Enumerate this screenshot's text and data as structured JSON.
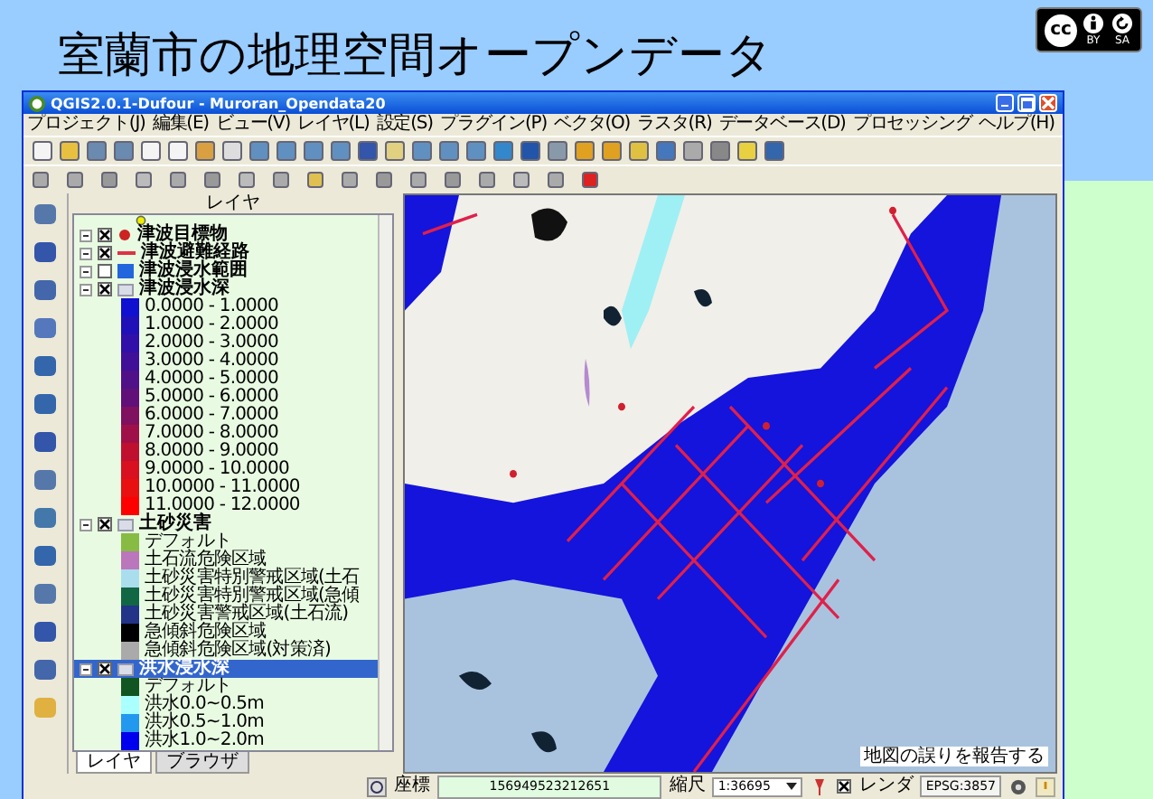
{
  "slide": {
    "title": "室蘭市の地理空間オープンデータ",
    "license": {
      "logo": "cc",
      "labels": [
        "BY",
        "SA"
      ]
    }
  },
  "window": {
    "title": "QGIS2.0.1-Dufour - Muroran_Opendata20"
  },
  "menu": [
    "プロジェクト(J)",
    "編集(E)",
    "ビュー(V)",
    "レイヤ(L)",
    "設定(S)",
    "プラグイン(P)",
    "ベクタ(O)",
    "ラスタ(R)",
    "データベース(D)",
    "プロセッシング",
    "ヘルプ(H)"
  ],
  "layers_panel": {
    "title": "レイヤ",
    "layers": [
      {
        "name": "津波目標物",
        "checked": true,
        "selected": false,
        "expanded": true,
        "symbol": {
          "kind": "point",
          "color": "#cc2222"
        }
      },
      {
        "name": "津波避難経路",
        "checked": true,
        "selected": false,
        "expanded": true,
        "symbol": {
          "kind": "line",
          "color": "#dd3344"
        }
      },
      {
        "name": "津波浸水範囲",
        "checked": false,
        "selected": false,
        "expanded": true,
        "symbol": {
          "kind": "polygon",
          "color": "#2266dd"
        }
      },
      {
        "name": "津波浸水深",
        "checked": true,
        "selected": false,
        "expanded": true,
        "children": [
          {
            "label": "0.0000 - 1.0000",
            "color": "#1010d0"
          },
          {
            "label": "1.0000 - 2.0000",
            "color": "#2010b8"
          },
          {
            "label": "2.0000 - 3.0000",
            "color": "#3010a8"
          },
          {
            "label": "3.0000 - 4.0000",
            "color": "#401098"
          },
          {
            "label": "4.0000 - 5.0000",
            "color": "#501088"
          },
          {
            "label": "5.0000 - 6.0000",
            "color": "#601078"
          },
          {
            "label": "6.0000 - 7.0000",
            "color": "#801060"
          },
          {
            "label": "7.0000 - 8.0000",
            "color": "#a01048"
          },
          {
            "label": "8.0000 - 9.0000",
            "color": "#c01030"
          },
          {
            "label": "9.0000 - 10.0000",
            "color": "#d81020"
          },
          {
            "label": "10.0000 - 11.0000",
            "color": "#e81010"
          },
          {
            "label": "11.0000 - 12.0000",
            "color": "#ff0000"
          }
        ]
      },
      {
        "name": "土砂災害",
        "checked": true,
        "selected": false,
        "expanded": true,
        "children": [
          {
            "label": "デフォルト",
            "color": "#88bb44"
          },
          {
            "label": "土石流危険区域",
            "color": "#bb77bb"
          },
          {
            "label": "土砂災害特別警戒区域(土石",
            "color": "#aaddee"
          },
          {
            "label": "土砂災害特別警戒区域(急傾",
            "color": "#116644"
          },
          {
            "label": "土砂災害警戒区域(土石流)",
            "color": "#223388"
          },
          {
            "label": "急傾斜危険区域",
            "color": "#000000"
          },
          {
            "label": "急傾斜危険区域(対策済)",
            "color": "#aaaaaa"
          }
        ]
      },
      {
        "name": "洪水浸水深",
        "checked": true,
        "selected": true,
        "expanded": true,
        "children": [
          {
            "label": "デフォルト",
            "color": "#115522"
          },
          {
            "label": "洪水0.0~0.5m",
            "color": "#aaffff"
          },
          {
            "label": "洪水0.5~1.0m",
            "color": "#2299ee"
          },
          {
            "label": "洪水1.0~2.0m",
            "color": "#0000ee"
          }
        ]
      }
    ],
    "tabs": [
      {
        "label": "レイヤ",
        "selected": true
      },
      {
        "label": "ブラウザ",
        "selected": false
      }
    ]
  },
  "map": {
    "link": "地図の誤りを報告する"
  },
  "status_bar": {
    "coordinate_label": "座標",
    "coordinate": "156949523212651",
    "scale_label": "縮尺",
    "scale": "1:36695",
    "render_label": "レンダ",
    "render_checked": true,
    "crs": "EPSG:3857"
  }
}
